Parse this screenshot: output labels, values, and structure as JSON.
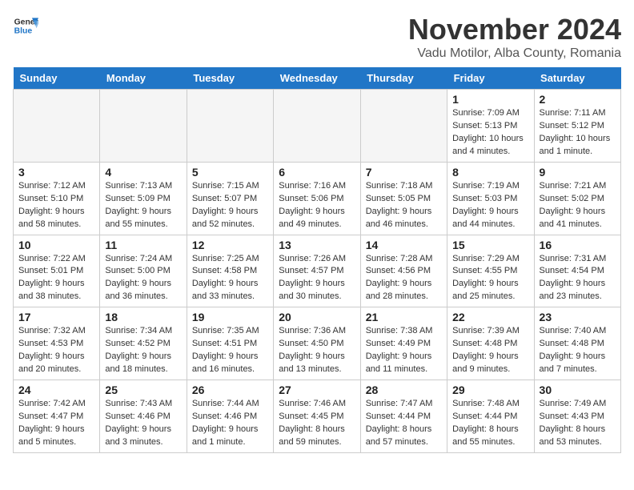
{
  "logo": {
    "text_general": "General",
    "text_blue": "Blue"
  },
  "title": "November 2024",
  "location": "Vadu Motilor, Alba County, Romania",
  "headers": [
    "Sunday",
    "Monday",
    "Tuesday",
    "Wednesday",
    "Thursday",
    "Friday",
    "Saturday"
  ],
  "weeks": [
    [
      {
        "day": "",
        "info": "",
        "shaded": true
      },
      {
        "day": "",
        "info": "",
        "shaded": true
      },
      {
        "day": "",
        "info": "",
        "shaded": true
      },
      {
        "day": "",
        "info": "",
        "shaded": true
      },
      {
        "day": "",
        "info": "",
        "shaded": true
      },
      {
        "day": "1",
        "info": "Sunrise: 7:09 AM\nSunset: 5:13 PM\nDaylight: 10 hours and 4 minutes.",
        "shaded": false
      },
      {
        "day": "2",
        "info": "Sunrise: 7:11 AM\nSunset: 5:12 PM\nDaylight: 10 hours and 1 minute.",
        "shaded": false
      }
    ],
    [
      {
        "day": "3",
        "info": "Sunrise: 7:12 AM\nSunset: 5:10 PM\nDaylight: 9 hours and 58 minutes.",
        "shaded": false
      },
      {
        "day": "4",
        "info": "Sunrise: 7:13 AM\nSunset: 5:09 PM\nDaylight: 9 hours and 55 minutes.",
        "shaded": false
      },
      {
        "day": "5",
        "info": "Sunrise: 7:15 AM\nSunset: 5:07 PM\nDaylight: 9 hours and 52 minutes.",
        "shaded": false
      },
      {
        "day": "6",
        "info": "Sunrise: 7:16 AM\nSunset: 5:06 PM\nDaylight: 9 hours and 49 minutes.",
        "shaded": false
      },
      {
        "day": "7",
        "info": "Sunrise: 7:18 AM\nSunset: 5:05 PM\nDaylight: 9 hours and 46 minutes.",
        "shaded": false
      },
      {
        "day": "8",
        "info": "Sunrise: 7:19 AM\nSunset: 5:03 PM\nDaylight: 9 hours and 44 minutes.",
        "shaded": false
      },
      {
        "day": "9",
        "info": "Sunrise: 7:21 AM\nSunset: 5:02 PM\nDaylight: 9 hours and 41 minutes.",
        "shaded": false
      }
    ],
    [
      {
        "day": "10",
        "info": "Sunrise: 7:22 AM\nSunset: 5:01 PM\nDaylight: 9 hours and 38 minutes.",
        "shaded": false
      },
      {
        "day": "11",
        "info": "Sunrise: 7:24 AM\nSunset: 5:00 PM\nDaylight: 9 hours and 36 minutes.",
        "shaded": false
      },
      {
        "day": "12",
        "info": "Sunrise: 7:25 AM\nSunset: 4:58 PM\nDaylight: 9 hours and 33 minutes.",
        "shaded": false
      },
      {
        "day": "13",
        "info": "Sunrise: 7:26 AM\nSunset: 4:57 PM\nDaylight: 9 hours and 30 minutes.",
        "shaded": false
      },
      {
        "day": "14",
        "info": "Sunrise: 7:28 AM\nSunset: 4:56 PM\nDaylight: 9 hours and 28 minutes.",
        "shaded": false
      },
      {
        "day": "15",
        "info": "Sunrise: 7:29 AM\nSunset: 4:55 PM\nDaylight: 9 hours and 25 minutes.",
        "shaded": false
      },
      {
        "day": "16",
        "info": "Sunrise: 7:31 AM\nSunset: 4:54 PM\nDaylight: 9 hours and 23 minutes.",
        "shaded": false
      }
    ],
    [
      {
        "day": "17",
        "info": "Sunrise: 7:32 AM\nSunset: 4:53 PM\nDaylight: 9 hours and 20 minutes.",
        "shaded": false
      },
      {
        "day": "18",
        "info": "Sunrise: 7:34 AM\nSunset: 4:52 PM\nDaylight: 9 hours and 18 minutes.",
        "shaded": false
      },
      {
        "day": "19",
        "info": "Sunrise: 7:35 AM\nSunset: 4:51 PM\nDaylight: 9 hours and 16 minutes.",
        "shaded": false
      },
      {
        "day": "20",
        "info": "Sunrise: 7:36 AM\nSunset: 4:50 PM\nDaylight: 9 hours and 13 minutes.",
        "shaded": false
      },
      {
        "day": "21",
        "info": "Sunrise: 7:38 AM\nSunset: 4:49 PM\nDaylight: 9 hours and 11 minutes.",
        "shaded": false
      },
      {
        "day": "22",
        "info": "Sunrise: 7:39 AM\nSunset: 4:48 PM\nDaylight: 9 hours and 9 minutes.",
        "shaded": false
      },
      {
        "day": "23",
        "info": "Sunrise: 7:40 AM\nSunset: 4:48 PM\nDaylight: 9 hours and 7 minutes.",
        "shaded": false
      }
    ],
    [
      {
        "day": "24",
        "info": "Sunrise: 7:42 AM\nSunset: 4:47 PM\nDaylight: 9 hours and 5 minutes.",
        "shaded": false
      },
      {
        "day": "25",
        "info": "Sunrise: 7:43 AM\nSunset: 4:46 PM\nDaylight: 9 hours and 3 minutes.",
        "shaded": false
      },
      {
        "day": "26",
        "info": "Sunrise: 7:44 AM\nSunset: 4:46 PM\nDaylight: 9 hours and 1 minute.",
        "shaded": false
      },
      {
        "day": "27",
        "info": "Sunrise: 7:46 AM\nSunset: 4:45 PM\nDaylight: 8 hours and 59 minutes.",
        "shaded": false
      },
      {
        "day": "28",
        "info": "Sunrise: 7:47 AM\nSunset: 4:44 PM\nDaylight: 8 hours and 57 minutes.",
        "shaded": false
      },
      {
        "day": "29",
        "info": "Sunrise: 7:48 AM\nSunset: 4:44 PM\nDaylight: 8 hours and 55 minutes.",
        "shaded": false
      },
      {
        "day": "30",
        "info": "Sunrise: 7:49 AM\nSunset: 4:43 PM\nDaylight: 8 hours and 53 minutes.",
        "shaded": false
      }
    ]
  ]
}
